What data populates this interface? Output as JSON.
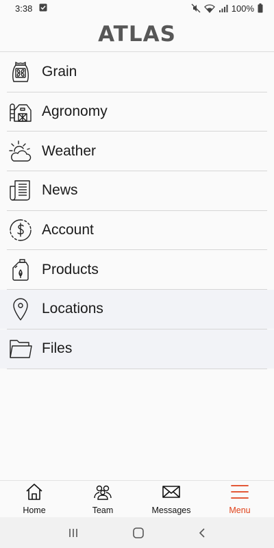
{
  "status": {
    "time": "3:38",
    "battery": "100%"
  },
  "header": {
    "title": "ATLAS"
  },
  "menu": {
    "items": [
      {
        "label": "Grain",
        "icon": "grain-bag-icon"
      },
      {
        "label": "Agronomy",
        "icon": "barn-icon"
      },
      {
        "label": "Weather",
        "icon": "sun-cloud-icon"
      },
      {
        "label": "News",
        "icon": "newspaper-icon"
      },
      {
        "label": "Account",
        "icon": "dollar-circle-icon"
      },
      {
        "label": "Products",
        "icon": "jug-icon"
      },
      {
        "label": "Locations",
        "icon": "map-pin-icon"
      },
      {
        "label": "Files",
        "icon": "folder-icon"
      }
    ]
  },
  "bottom_nav": {
    "items": [
      {
        "label": "Home",
        "icon": "home-icon"
      },
      {
        "label": "Team",
        "icon": "team-icon"
      },
      {
        "label": "Messages",
        "icon": "envelope-icon"
      },
      {
        "label": "Menu",
        "icon": "hamburger-icon"
      }
    ]
  },
  "colors": {
    "accent": "#e0421a",
    "title": "#575757",
    "alt_row_bg": "#f2f3f7"
  }
}
